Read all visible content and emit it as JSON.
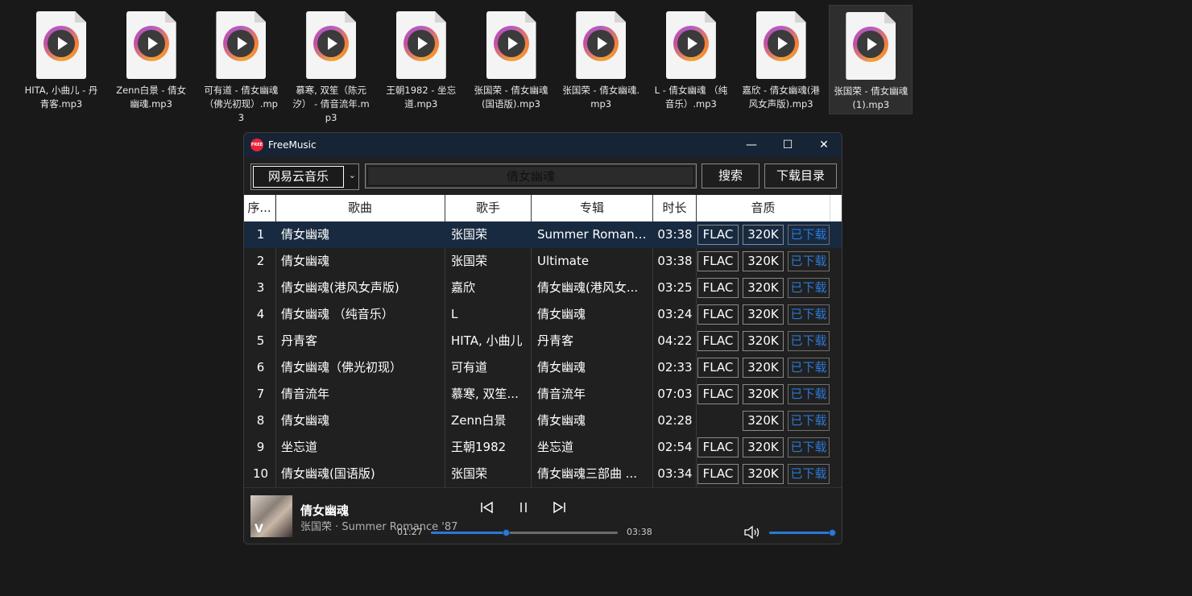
{
  "desktop": {
    "files": [
      {
        "name": "HITA, 小曲儿 - 丹青客.mp3",
        "selected": false
      },
      {
        "name": "Zenn白景 - 倩女幽魂.mp3",
        "selected": false
      },
      {
        "name": "可有道 - 倩女幽魂（佛光初现）.mp3",
        "selected": false
      },
      {
        "name": "慕寒, 双笙（陈元汐） - 倩音流年.mp3",
        "selected": false
      },
      {
        "name": "王朝1982 - 坐忘道.mp3",
        "selected": false
      },
      {
        "name": "张国荣 - 倩女幽魂(国语版).mp3",
        "selected": false
      },
      {
        "name": "张国荣 - 倩女幽魂.mp3",
        "selected": false
      },
      {
        "name": "L - 倩女幽魂 （纯音乐）.mp3",
        "selected": false
      },
      {
        "name": "嘉欣 - 倩女幽魂(港风女声版).mp3",
        "selected": false
      },
      {
        "name": "张国荣 - 倩女幽魂 (1).mp3",
        "selected": true
      }
    ]
  },
  "window": {
    "title": "FreeMusic",
    "logo_text": "FREE",
    "minimize": "—",
    "maximize": "☐",
    "close": "✕"
  },
  "toolbar": {
    "source": "网易云音乐",
    "search_value": "倩女幽魂",
    "search_label": "搜索",
    "download_dir_label": "下载目录"
  },
  "table": {
    "headers": [
      "序...",
      "歌曲",
      "歌手",
      "专辑",
      "时长",
      "音质"
    ],
    "rows": [
      {
        "idx": "1",
        "song": "倩女幽魂",
        "artist": "张国荣",
        "album": "Summer Romance '...",
        "duration": "03:38",
        "flac": "FLAC",
        "k320": "320K",
        "dl": "已下载"
      },
      {
        "idx": "2",
        "song": "倩女幽魂",
        "artist": "张国荣",
        "album": "Ultimate",
        "duration": "03:38",
        "flac": "FLAC",
        "k320": "320K",
        "dl": "已下载"
      },
      {
        "idx": "3",
        "song": "倩女幽魂(港风女声版)",
        "artist": "嘉欣",
        "album": "倩女幽魂(港风女...",
        "duration": "03:25",
        "flac": "FLAC",
        "k320": "320K",
        "dl": "已下载"
      },
      {
        "idx": "4",
        "song": "倩女幽魂 （纯音乐）",
        "artist": "L",
        "album": "倩女幽魂",
        "duration": "03:24",
        "flac": "FLAC",
        "k320": "320K",
        "dl": "已下载"
      },
      {
        "idx": "5",
        "song": "丹青客",
        "artist": "HITA, 小曲儿",
        "album": "丹青客",
        "duration": "04:22",
        "flac": "FLAC",
        "k320": "320K",
        "dl": "已下载"
      },
      {
        "idx": "6",
        "song": "倩女幽魂（佛光初现）",
        "artist": "可有道",
        "album": "倩女幽魂",
        "duration": "02:33",
        "flac": "FLAC",
        "k320": "320K",
        "dl": "已下载"
      },
      {
        "idx": "7",
        "song": "倩音流年",
        "artist": "慕寒, 双笙...",
        "album": "倩音流年",
        "duration": "07:03",
        "flac": "FLAC",
        "k320": "320K",
        "dl": "已下载"
      },
      {
        "idx": "8",
        "song": "倩女幽魂",
        "artist": "Zenn白景",
        "album": "倩女幽魂",
        "duration": "02:28",
        "flac": "",
        "k320": "320K",
        "dl": "已下载"
      },
      {
        "idx": "9",
        "song": "坐忘道",
        "artist": "王朝1982",
        "album": "坐忘道",
        "duration": "02:54",
        "flac": "FLAC",
        "k320": "320K",
        "dl": "已下载"
      },
      {
        "idx": "10",
        "song": "倩女幽魂(国语版)",
        "artist": "张国荣",
        "album": "倩女幽魂三部曲 ...",
        "duration": "03:34",
        "flac": "FLAC",
        "k320": "320K",
        "dl": "已下载"
      }
    ]
  },
  "player": {
    "title": "倩女幽魂",
    "subtitle": "张国荣 · Summer Romance '87",
    "cover_text": "V",
    "current_time": "01:27",
    "total_time": "03:38",
    "progress": 0.4,
    "volume": 1.0,
    "accent": "#2b79d6"
  }
}
